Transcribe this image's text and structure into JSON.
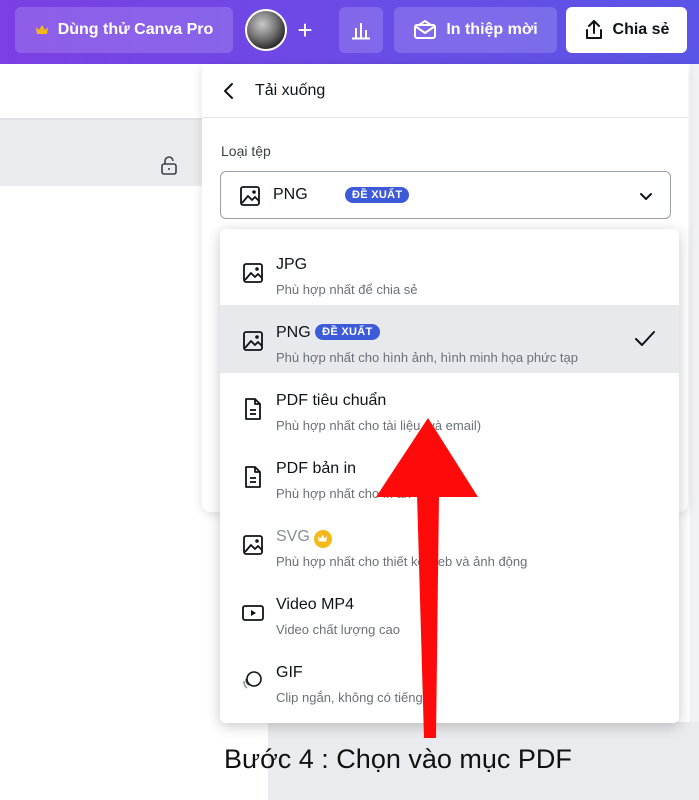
{
  "topbar": {
    "pro_label": "Dùng thử Canva Pro",
    "invite_label": "In thiệp mời",
    "share_label": "Chia sẻ",
    "plus_glyph": "+"
  },
  "panel": {
    "title": "Tải xuống",
    "filetype_label": "Loại tệp",
    "selected_value": "PNG",
    "selected_badge": "ĐỀ XUẤT"
  },
  "options": [
    {
      "name": "JPG",
      "desc": "Phù hợp nhất để chia sẻ",
      "icon": "image-icon"
    },
    {
      "name": "PNG",
      "badge": "ĐỀ XUẤT",
      "desc": "Phù hợp nhất cho hình ảnh, hình minh họa phức tạp",
      "icon": "image-icon",
      "selected": true
    },
    {
      "name": "PDF tiêu chuẩn",
      "desc": "Phù hợp nhất cho tài liệu (và email)",
      "icon": "document-icon"
    },
    {
      "name": "PDF bản in",
      "desc": "Phù hợp nhất cho in ấn",
      "icon": "document-icon"
    },
    {
      "name": "SVG",
      "desc": "Phù hợp nhất cho thiết kế web và ảnh động",
      "icon": "image-icon",
      "pro": true
    },
    {
      "name": "Video MP4",
      "desc": "Video chất lượng cao",
      "icon": "video-icon"
    },
    {
      "name": "GIF",
      "desc": "Clip ngắn, không có tiếng",
      "icon": "gif-icon"
    }
  ],
  "annotation": {
    "caption": "Bước 4 : Chọn vào mục  PDF",
    "arrow_color": "#ff0a0a"
  },
  "colors": {
    "topbar_start": "#7b3fe4",
    "topbar_end": "#5a55e6",
    "badge": "#3d5bd9",
    "crown": "#f5b819",
    "selected_row": "#e7e9ec"
  }
}
